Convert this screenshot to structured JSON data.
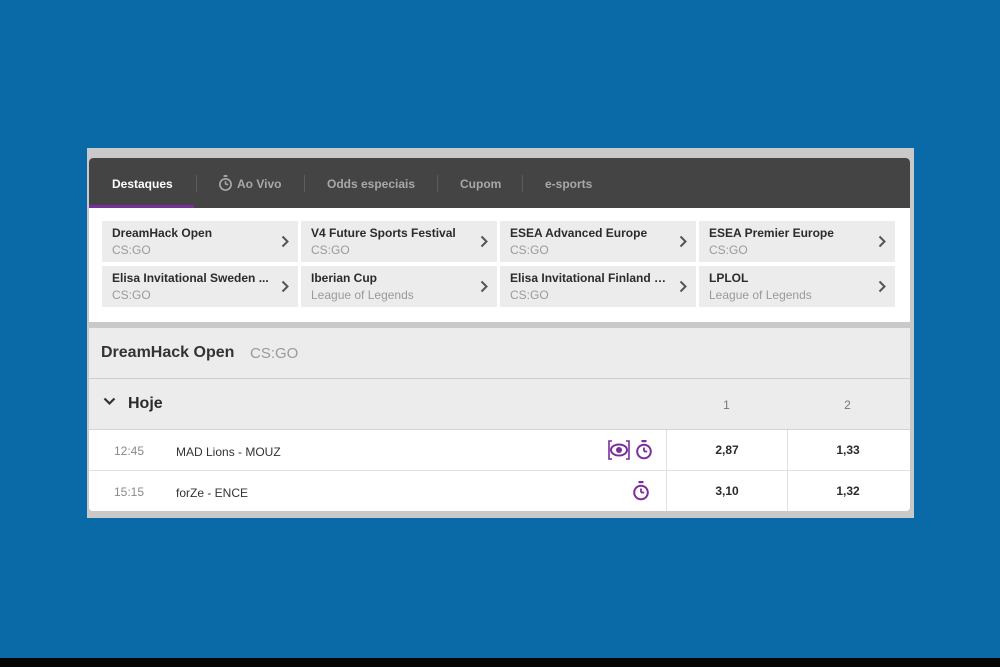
{
  "nav": {
    "tabs": [
      {
        "label": "Destaques",
        "active": true
      },
      {
        "label": "Ao Vivo",
        "icon": "stopwatch-icon"
      },
      {
        "label": "Odds especiais"
      },
      {
        "label": "Cupom"
      },
      {
        "label": "e-sports"
      }
    ]
  },
  "highlights": [
    {
      "name": "DreamHack Open",
      "sport": "CS:GO"
    },
    {
      "name": "V4 Future Sports Festival",
      "sport": "CS:GO"
    },
    {
      "name": "ESEA Advanced Europe",
      "sport": "CS:GO"
    },
    {
      "name": "ESEA Premier Europe",
      "sport": "CS:GO"
    },
    {
      "name": "Elisa Invitational Sweden ...",
      "sport": "CS:GO"
    },
    {
      "name": "Iberian Cup",
      "sport": "League of Legends"
    },
    {
      "name": "Elisa Invitational Finland Q...",
      "sport": "CS:GO"
    },
    {
      "name": "LPLOL",
      "sport": "League of Legends"
    }
  ],
  "league": {
    "title": "DreamHack Open",
    "sport": "CS:GO"
  },
  "day": {
    "label": "Hoje",
    "col1": "1",
    "col2": "2"
  },
  "matches": [
    {
      "time": "12:45",
      "teams": "MAD Lions  - MOUZ",
      "odd1": "2,87",
      "odd2": "1,33",
      "icons": [
        "live-stream-icon",
        "stopwatch-icon"
      ]
    },
    {
      "time": "15:15",
      "teams": "forZe  - ENCE",
      "odd1": "3,10",
      "odd2": "1,32",
      "icons": [
        "stopwatch-icon"
      ]
    }
  ],
  "colors": {
    "background": "#0a6aa8",
    "nav": "#444444",
    "accent": "#7a2e9c",
    "card": "#ececec"
  }
}
